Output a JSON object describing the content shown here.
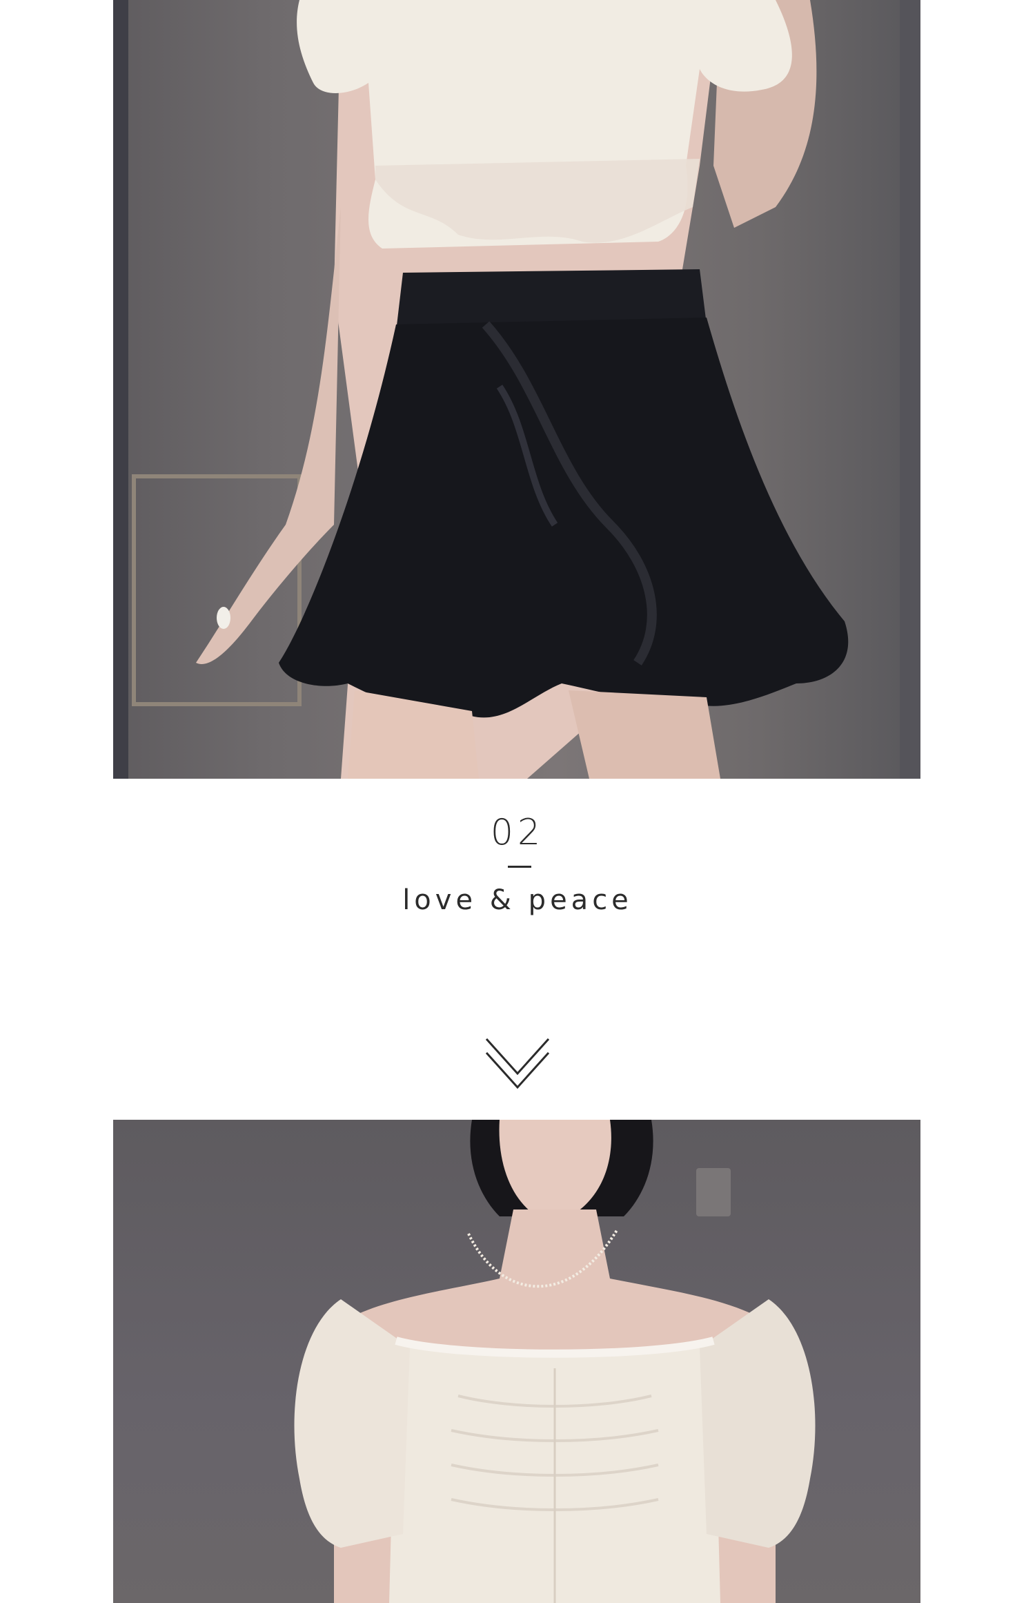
{
  "section": {
    "number": "02",
    "subtitle": "love & peace"
  },
  "icons": {
    "scroll_indicator": "double-chevron-down-icon"
  },
  "colors": {
    "background": "#ffffff",
    "text": "#2b2b2b",
    "chevron": "#2b2b2b"
  }
}
